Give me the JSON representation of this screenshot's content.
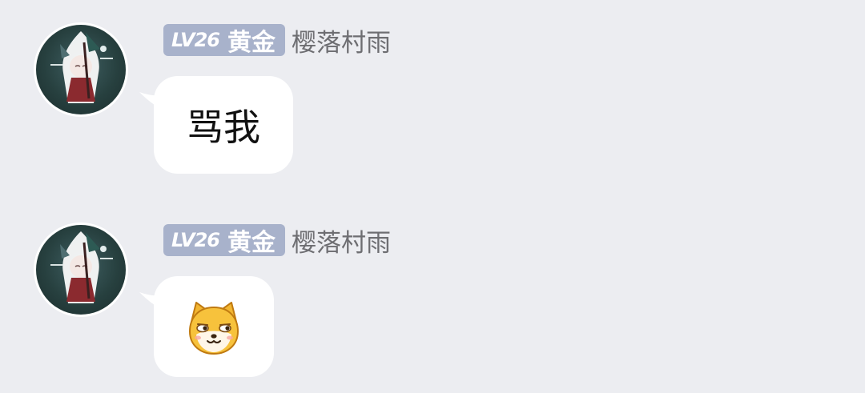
{
  "messages": [
    {
      "level": "LV26",
      "title": "黄金",
      "username": "樱落村雨",
      "text": "骂我"
    },
    {
      "level": "LV26",
      "title": "黄金",
      "username": "樱落村雨",
      "sticker": "dog-face-sticker"
    }
  ],
  "colors": {
    "background": "#ECEDF1",
    "badge": "#A8B2CB",
    "bubble": "#FFFFFF",
    "username": "#6E6E72"
  }
}
